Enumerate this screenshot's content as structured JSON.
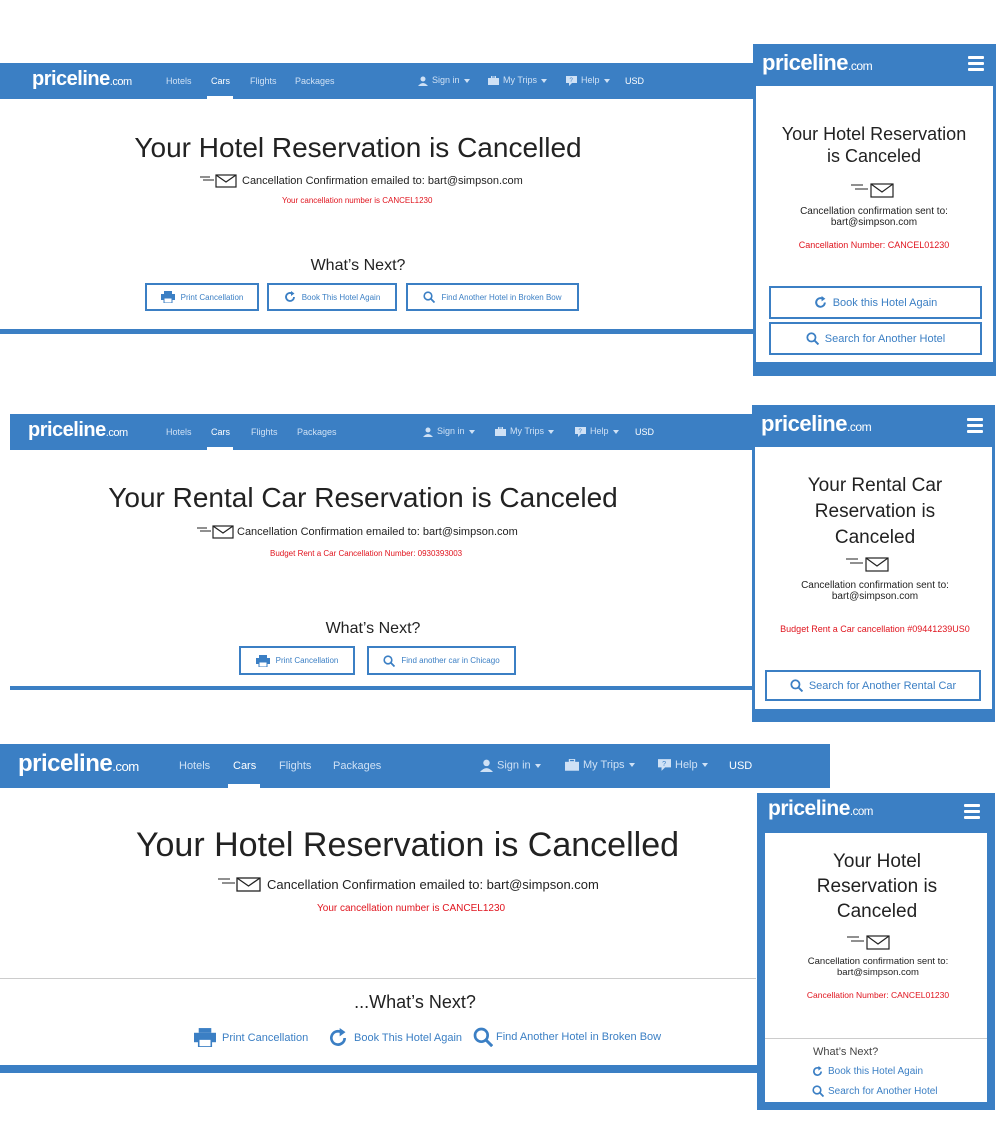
{
  "colors": {
    "brand": "#3b7fc4",
    "error": "#e0141e",
    "nav_text": "#cfe1f5"
  },
  "logo": {
    "main": "priceline",
    "suffix": ".com"
  },
  "nav": {
    "tabs": [
      "Hotels",
      "Cars",
      "Flights",
      "Packages"
    ],
    "sign_in": "Sign in",
    "my_trips": "My Trips",
    "help": "Help",
    "currency": "USD"
  },
  "panel1": {
    "title": "Your Hotel Reservation is Cancelled",
    "email_text": "Cancellation Confirmation emailed to: bart@simpson.com",
    "cancel_number": "Your cancellation number is CANCEL1230",
    "whats_next": "What’s Next?",
    "buttons": [
      "Print Cancellation",
      "Book This Hotel Again",
      "Find Another Hotel in Broken Bow"
    ]
  },
  "mobile1": {
    "title_line1": "Your Hotel Reservation",
    "title_line2": "is Canceled",
    "sent_to_label": "Cancellation confirmation sent to:",
    "email": "bart@simpson.com",
    "cancel_number": "Cancellation Number: CANCEL01230",
    "buttons": [
      "Book this Hotel Again",
      "Search for Another Hotel"
    ]
  },
  "panel2": {
    "title": "Your Rental Car Reservation is Canceled",
    "email_text": "Cancellation Confirmation emailed to: bart@simpson.com",
    "cancel_number": "Budget Rent a Car Cancellation Number: 0930393003",
    "whats_next": "What’s Next?",
    "buttons": [
      "Print Cancellation",
      "Find another car in Chicago"
    ]
  },
  "mobile2": {
    "title_line1": "Your Rental Car",
    "title_line2": "Reservation is",
    "title_line3": "Canceled",
    "sent_to_label": "Cancellation confirmation sent to:",
    "email": "bart@simpson.com",
    "cancel_number": "Budget Rent a Car cancellation #09441239US0",
    "buttons": [
      "Search for Another Rental Car"
    ]
  },
  "panel3": {
    "title": "Your Hotel Reservation is Cancelled",
    "email_text": "Cancellation Confirmation emailed to: bart@simpson.com",
    "cancel_number": "Your cancellation number is CANCEL1230",
    "whats_next": "...What’s Next?",
    "links": [
      "Print Cancellation",
      "Book This Hotel Again",
      "Find Another Hotel in Broken Bow"
    ]
  },
  "mobile3": {
    "title_line1": "Your Hotel",
    "title_line2": "Reservation is",
    "title_line3": "Canceled",
    "sent_to_label": "Cancellation confirmation sent to:",
    "email": "bart@simpson.com",
    "cancel_number": "Cancellation Number: CANCEL01230",
    "whats_next": "What’s Next?",
    "links": [
      "Book this Hotel Again",
      "Search for Another Hotel"
    ]
  }
}
